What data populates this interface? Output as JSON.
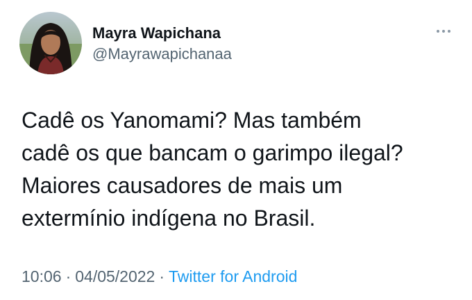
{
  "author": {
    "display_name": "Mayra Wapichana",
    "handle": "@Mayrawapichanaa"
  },
  "tweet": {
    "lines": [
      "Cadê os Yanomami? Mas também",
      "cadê os que bancam o garimpo ilegal?",
      "Maiores causadores de mais um",
      "extermínio indígena no Brasil."
    ]
  },
  "meta": {
    "time": "10:06",
    "separator": "·",
    "date": "04/05/2022",
    "source": "Twitter for Android"
  },
  "icons": {
    "more": "more-horizontal-icon"
  },
  "colors": {
    "text": "#0f1419",
    "secondary": "#536471",
    "link": "#1d9bf0"
  }
}
